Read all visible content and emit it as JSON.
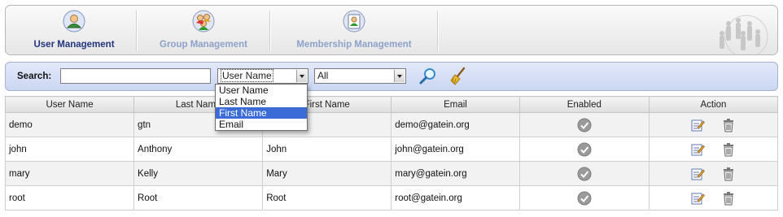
{
  "tabs": [
    {
      "label": "User Management",
      "icon": "user-icon",
      "active": true
    },
    {
      "label": "Group Management",
      "icon": "group-icon",
      "active": false
    },
    {
      "label": "Membership Management",
      "icon": "membership-icon",
      "active": false
    }
  ],
  "search": {
    "label": "Search:",
    "value": "",
    "field_selected": "User Name",
    "status_selected": "All",
    "field_options": [
      "User Name",
      "Last Name",
      "First Name",
      "Email"
    ],
    "highlighted_option": "First Name"
  },
  "table": {
    "headers": [
      "User Name",
      "Last Name",
      "First Name",
      "Email",
      "Enabled",
      "Action"
    ],
    "rows": [
      {
        "user": "demo",
        "last": "gtn",
        "first": "",
        "email": "demo@gatein.org",
        "enabled": true
      },
      {
        "user": "john",
        "last": "Anthony",
        "first": "John",
        "email": "john@gatein.org",
        "enabled": true
      },
      {
        "user": "mary",
        "last": "Kelly",
        "first": "Mary",
        "email": "mary@gatein.org",
        "enabled": true
      },
      {
        "user": "root",
        "last": "Root",
        "first": "Root",
        "email": "root@gatein.org",
        "enabled": true
      }
    ]
  },
  "colors": {
    "active_tab": "#23347d",
    "inactive_tab": "#8ea1c8",
    "search_bar": "#cbd6f2",
    "dropdown_highlight": "#3a6bd6"
  }
}
